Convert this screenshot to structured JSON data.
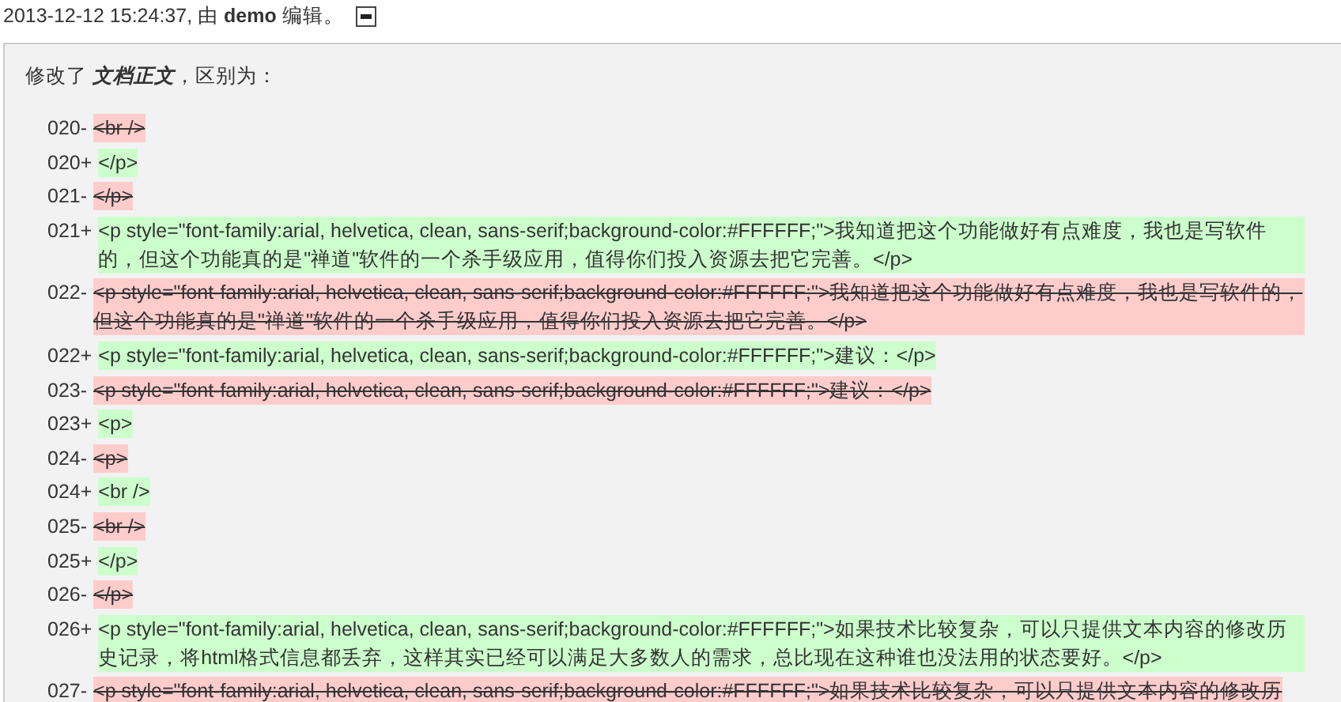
{
  "header": {
    "text": "2013-12-12 15:24:37, 由 **demo** 编辑。",
    "collapsed": false
  },
  "panel": {
    "intro": "修改了 **文档正文**，区别为：",
    "lines": [
      {
        "number": "020-",
        "kind": "removed",
        "text": "<br />"
      },
      {
        "number": "020+",
        "kind": "added",
        "text": "</p>"
      },
      {
        "number": "021-",
        "kind": "removed",
        "text": "</p>"
      },
      {
        "number": "021+",
        "kind": "added",
        "text": "<p style=\"font-family:arial, helvetica, clean, sans-serif;background-color:#FFFFFF;\">我知道把这个功能做好有点难度，我也是写软件的，但这个功能真的是\"禅道\"软件的一个杀手级应用，值得你们投入资源去把它完善。</p>"
      },
      {
        "number": "022-",
        "kind": "removed",
        "text": "<p style=\"font-family:arial, helvetica, clean, sans-serif;background-color:#FFFFFF;\">我知道把这个功能做好有点难度，我也是写软件的，但这个功能真的是\"禅道\"软件的一个杀手级应用，值得你们投入资源去把它完善。</p>"
      },
      {
        "number": "022+",
        "kind": "added",
        "text": "<p style=\"font-family:arial, helvetica, clean, sans-serif;background-color:#FFFFFF;\">建议：</p>"
      },
      {
        "number": "023-",
        "kind": "removed",
        "text": "<p style=\"font-family:arial, helvetica, clean, sans-serif;background-color:#FFFFFF;\">建议：</p>"
      },
      {
        "number": "023+",
        "kind": "added",
        "text": "<p>"
      },
      {
        "number": "024-",
        "kind": "removed",
        "text": "<p>"
      },
      {
        "number": "024+",
        "kind": "added",
        "text": "<br />"
      },
      {
        "number": "025-",
        "kind": "removed",
        "text": "<br />"
      },
      {
        "number": "025+",
        "kind": "added",
        "text": "</p>"
      },
      {
        "number": "026-",
        "kind": "removed",
        "text": "</p>"
      },
      {
        "number": "026+",
        "kind": "added",
        "text": "<p style=\"font-family:arial, helvetica, clean, sans-serif;background-color:#FFFFFF;\">如果技术比较复杂，可以只提供文本内容的修改历史记录，将html格式信息都丢弃，这样其实已经可以满足大多数人的需求，总比现在这种谁也没法用的状态要好。</p>"
      },
      {
        "number": "027-",
        "kind": "removed",
        "text": "<p style=\"font-family:arial, helvetica, clean, sans-serif;background-color:#FFFFFF;\">如果技术比较复杂，可以只提供文本内容的修改历"
      }
    ]
  }
}
